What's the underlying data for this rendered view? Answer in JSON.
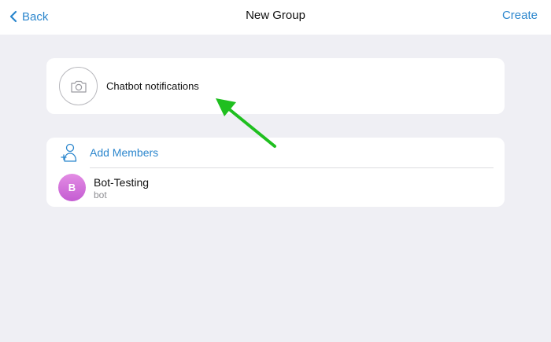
{
  "navbar": {
    "back_label": "Back",
    "title": "New Group",
    "create_label": "Create"
  },
  "group": {
    "name_value": "Chatbot notifications",
    "photo_icon": "camera-icon"
  },
  "members": {
    "add_label": "Add Members",
    "add_icon": "add-user-icon",
    "items": [
      {
        "initial": "B",
        "name": "Bot-Testing",
        "status": "bot"
      }
    ]
  },
  "annotation": {
    "icon": "arrow-icon",
    "color": "#1fbf1f"
  },
  "colors": {
    "accent": "#2b86cd",
    "background": "#efeff4",
    "avatar": "#d575dd"
  }
}
